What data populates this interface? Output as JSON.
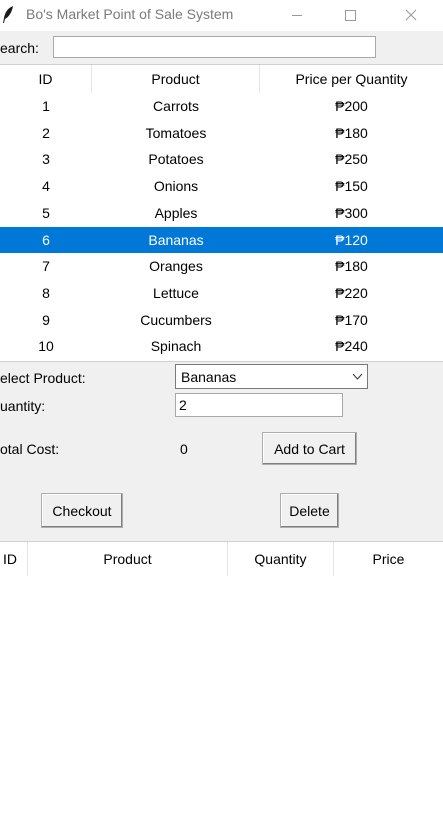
{
  "window": {
    "title": "Bo's Market Point of Sale System",
    "icon": "feather-icon"
  },
  "search": {
    "label": "earch:",
    "value": ""
  },
  "products_table": {
    "headers": [
      "ID",
      "Product",
      "Price per Quantity"
    ],
    "rows": [
      {
        "id": "1",
        "product": "Carrots",
        "price": "₱200"
      },
      {
        "id": "2",
        "product": "Tomatoes",
        "price": "₱180"
      },
      {
        "id": "3",
        "product": "Potatoes",
        "price": "₱250"
      },
      {
        "id": "4",
        "product": "Onions",
        "price": "₱150"
      },
      {
        "id": "5",
        "product": "Apples",
        "price": "₱300"
      },
      {
        "id": "6",
        "product": "Bananas",
        "price": "₱120"
      },
      {
        "id": "7",
        "product": "Oranges",
        "price": "₱180"
      },
      {
        "id": "8",
        "product": "Lettuce",
        "price": "₱220"
      },
      {
        "id": "9",
        "product": "Cucumbers",
        "price": "₱170"
      },
      {
        "id": "10",
        "product": "Spinach",
        "price": "₱240"
      }
    ],
    "selected_row": 5
  },
  "form": {
    "select_label": "elect Product:",
    "selected_product": "Bananas",
    "quantity_label": "uantity:",
    "quantity_value": "2",
    "total_label": "otal Cost:",
    "total_value": "0",
    "add_to_cart_label": "Add to Cart",
    "checkout_label": "Checkout",
    "delete_label": "Delete"
  },
  "cart_table": {
    "headers": [
      "ID",
      "Product",
      "Quantity",
      "Price"
    ],
    "rows": []
  },
  "colors": {
    "selection": "#0078d7",
    "background": "#f0f0f0"
  }
}
